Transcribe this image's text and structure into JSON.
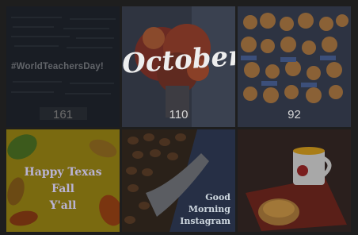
{
  "gallery": {
    "tiles": [
      {
        "count": "161",
        "caption": "#WorldTeachersDay!",
        "icon": "chalkboard-icon"
      },
      {
        "count": "110",
        "caption": "October",
        "icon": "flowers-icon"
      },
      {
        "count": "92",
        "icon": "pastries-icon"
      },
      {
        "caption_lines": [
          "Happy Texas",
          "Fall",
          "Y'all"
        ],
        "icon": "leaves-icon"
      },
      {
        "caption_lines": [
          "Good",
          "Morning",
          "Instagram"
        ],
        "icon": "coffee-beans-icon"
      },
      {
        "icon": "mug-and-bread-icon"
      }
    ]
  }
}
